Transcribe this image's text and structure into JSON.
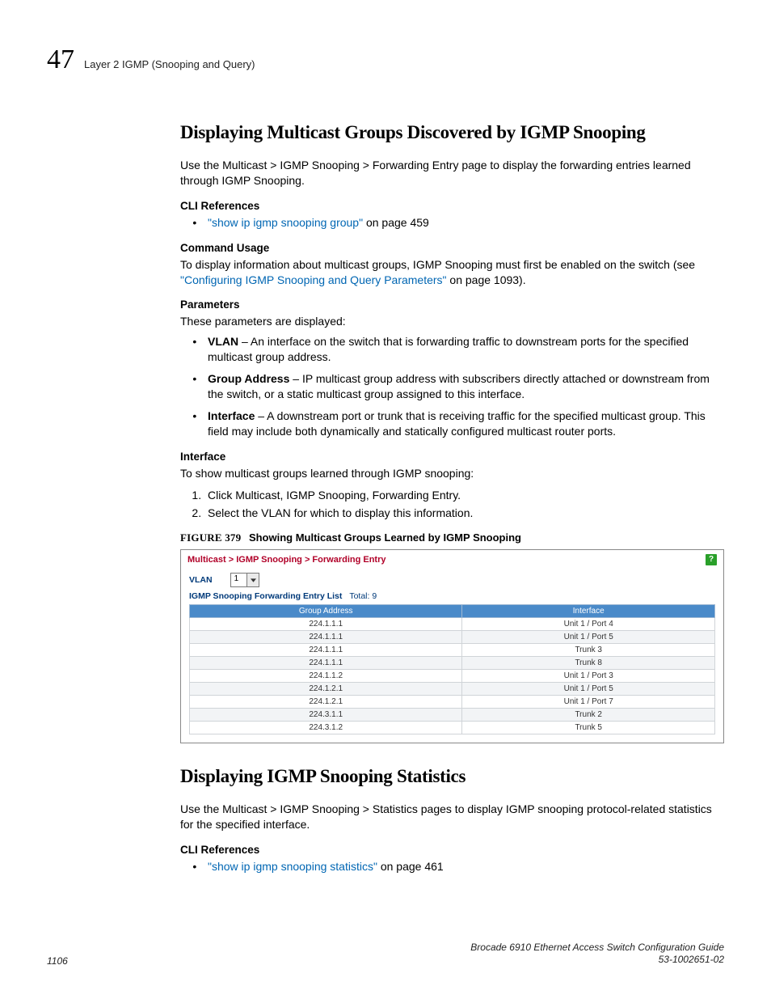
{
  "header": {
    "chapter_number": "47",
    "running_title": "Layer 2 IGMP (Snooping and Query)"
  },
  "section1": {
    "title": "Displaying Multicast Groups Discovered by IGMP Snooping",
    "intro": "Use the Multicast > IGMP Snooping > Forwarding Entry page to display the forwarding entries learned through IGMP Snooping.",
    "cli_head": "CLI References",
    "cli_link_text": "\"show ip igmp snooping group\"",
    "cli_link_tail": " on page 459",
    "cmd_head": "Command Usage",
    "cmd_pre": "To display information about multicast groups, IGMP Snooping must first be enabled on the switch (see ",
    "cmd_link": "\"Configuring IGMP Snooping and Query Parameters\"",
    "cmd_post": " on page 1093).",
    "param_head": "Parameters",
    "param_intro": "These parameters are displayed:",
    "params": [
      {
        "term": "VLAN",
        "desc": " – An interface on the switch that is forwarding traffic to downstream ports for the specified multicast group address."
      },
      {
        "term": "Group Address",
        "desc": " – IP multicast group address with subscribers directly attached or downstream from the switch, or a static multicast group assigned to this interface."
      },
      {
        "term": "Interface",
        "desc": " – A downstream port or trunk that is receiving traffic for the specified multicast group. This field may include both dynamically and statically configured multicast router ports."
      }
    ],
    "iface_head": "Interface",
    "iface_intro": "To show multicast groups learned through IGMP snooping:",
    "steps": [
      "Click Multicast, IGMP Snooping, Forwarding Entry.",
      "Select the VLAN for which to display this information."
    ],
    "fig_label": "FIGURE 379",
    "fig_title": "Showing Multicast Groups Learned by IGMP Snooping"
  },
  "shot": {
    "breadcrumb": "Multicast > IGMP Snooping > Forwarding Entry",
    "help_glyph": "?",
    "vlan_label": "VLAN",
    "vlan_value": "1",
    "list_title": "IGMP Snooping Forwarding Entry List",
    "total_label": "Total: 9",
    "col1": "Group Address",
    "col2": "Interface",
    "rows": [
      {
        "addr": "224.1.1.1",
        "iface": "Unit 1 / Port 4"
      },
      {
        "addr": "224.1.1.1",
        "iface": "Unit 1 / Port 5"
      },
      {
        "addr": "224.1.1.1",
        "iface": "Trunk 3"
      },
      {
        "addr": "224.1.1.1",
        "iface": "Trunk 8"
      },
      {
        "addr": "224.1.1.2",
        "iface": "Unit 1 / Port 3"
      },
      {
        "addr": "224.1.2.1",
        "iface": "Unit 1 / Port 5"
      },
      {
        "addr": "224.1.2.1",
        "iface": "Unit 1 / Port 7"
      },
      {
        "addr": "224.3.1.1",
        "iface": "Trunk 2"
      },
      {
        "addr": "224.3.1.2",
        "iface": "Trunk 5"
      }
    ]
  },
  "section2": {
    "title": "Displaying IGMP Snooping Statistics",
    "intro": "Use the Multicast > IGMP Snooping > Statistics pages to display IGMP snooping protocol-related statistics for the specified interface.",
    "cli_head": "CLI References",
    "cli_link_text": "\"show ip igmp snooping statistics\"",
    "cli_link_tail": " on page 461"
  },
  "footer": {
    "page": "1106",
    "book": "Brocade 6910 Ethernet Access Switch Configuration Guide",
    "docnum": "53-1002651-02"
  }
}
